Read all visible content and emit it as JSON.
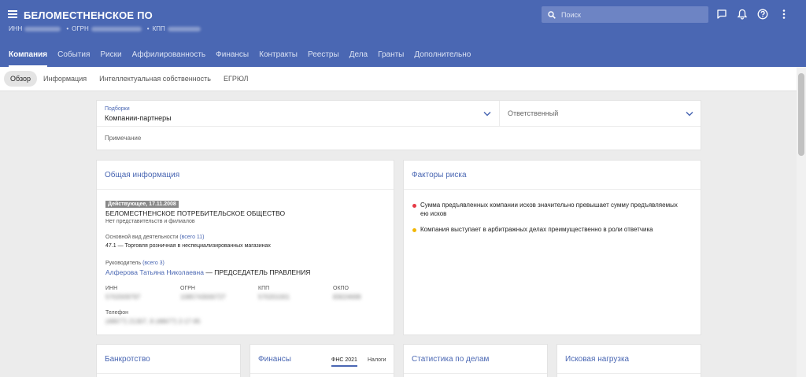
{
  "header": {
    "company_name": "БЕЛОМЕСТНЕНСКОЕ ПО",
    "ids": [
      {
        "label": "ИНН",
        "value": "5702009797"
      },
      {
        "label": "ОГРН",
        "value": "1085743000727"
      },
      {
        "label": "КПП",
        "value": "570201001"
      }
    ],
    "search_placeholder": "Поиск",
    "icons": [
      "chat-icon",
      "bell-icon",
      "help-icon",
      "more-vertical-icon"
    ]
  },
  "nav": {
    "tabs": [
      {
        "label": "Компания",
        "active": true
      },
      {
        "label": "События"
      },
      {
        "label": "Риски"
      },
      {
        "label": "Аффилированность"
      },
      {
        "label": "Финансы"
      },
      {
        "label": "Контракты"
      },
      {
        "label": "Реестры"
      },
      {
        "label": "Дела"
      },
      {
        "label": "Гранты"
      },
      {
        "label": "Дополнительно"
      }
    ]
  },
  "subnav": {
    "items": [
      {
        "label": "Обзор",
        "active": true
      },
      {
        "label": "Информация"
      },
      {
        "label": "Интеллектуальная собственность"
      },
      {
        "label": "ЕГРЮЛ"
      }
    ]
  },
  "top_card": {
    "selections_label": "Подборки",
    "selections_value": "Компании-партнеры",
    "responsible_placeholder": "Ответственный",
    "note_placeholder": "Примечание"
  },
  "general": {
    "title": "Общая информация",
    "status_badge": "Действующее, 17.11.2008",
    "full_name": "БЕЛОМЕСТНЕНСКОЕ ПОТРЕБИТЕЛЬСКОЕ ОБЩЕСТВО",
    "branches": "Нет представительств и филиалов",
    "activity_label": "Основной вид деятельности",
    "activity_link": "(всего 11)",
    "activity_value": "47.1 — Торговля розничная в неспециализированных магазинах",
    "head_label": "Руководитель",
    "head_link": "(всего 3)",
    "head_name": "Алферова Татьяна Николаевна",
    "head_role": "— ПРЕДСЕДАТЕЛЬ ПРАВЛЕНИЯ",
    "codes": [
      {
        "label": "ИНН",
        "value": "5702009797"
      },
      {
        "label": "ОГРН",
        "value": "1085743000727"
      },
      {
        "label": "КПП",
        "value": "570201001"
      },
      {
        "label": "ОКПО",
        "value": "83024699"
      }
    ],
    "phone_label": "Телефон",
    "phone_value": "(48677) 21307, 8 (48677) 2-17-95"
  },
  "risks": {
    "title": "Факторы риска",
    "items": [
      {
        "text": "Сумма предъявленных компании исков значительно превышает сумму предъявляемых ею исков",
        "color": "#e53945"
      },
      {
        "text": "Компания выступает в арбитражных делах преимущественно в роли ответчика",
        "color": "#f2b705"
      }
    ]
  },
  "bottom_cards": {
    "bankruptcy": "Банкротство",
    "finance": "Финансы",
    "finance_tabs": [
      "ФНС 2021",
      "Налоги"
    ],
    "case_stats": "Статистика по делам",
    "claims": "Исковая нагрузка"
  }
}
